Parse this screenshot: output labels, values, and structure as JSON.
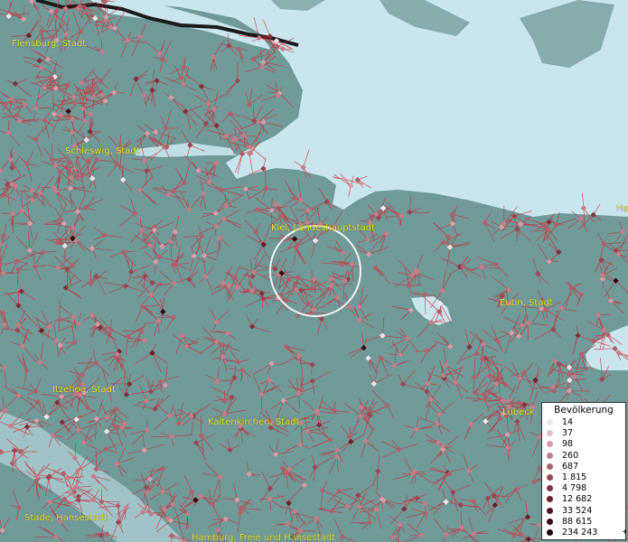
{
  "map": {
    "colors": {
      "land": "#6f9a98",
      "water": "#c9e6ee",
      "boundary": "#d4202a",
      "label": "#e8e23a"
    },
    "places": [
      {
        "id": "flensburg",
        "label": "Flensburg, Stadt"
      },
      {
        "id": "schleswig",
        "label": "Schleswig, Stadt"
      },
      {
        "id": "kiel",
        "label": "Kiel, Landeshauptstadt"
      },
      {
        "id": "eutin",
        "label": "Eutin, Stadt"
      },
      {
        "id": "itzehoe",
        "label": "Itzehoe, Stadt"
      },
      {
        "id": "kaltenkirchen",
        "label": "Kaltenkirchen, Stadt"
      },
      {
        "id": "luebeck",
        "label": "Lübeck,"
      },
      {
        "id": "stade",
        "label": "Stade, Hansestadt"
      },
      {
        "id": "hamburg",
        "label": "Hamburg, Freie und Hansestadt"
      },
      {
        "id": "he-cut",
        "label": "He"
      }
    ]
  },
  "legend": {
    "title": "Bevölkerung",
    "entries": [
      {
        "label": "14",
        "color": "#f6e4ea"
      },
      {
        "label": "37",
        "color": "#e9bfca"
      },
      {
        "label": "98",
        "color": "#d89ca8"
      },
      {
        "label": "260",
        "color": "#c57d88"
      },
      {
        "label": "687",
        "color": "#b0606b"
      },
      {
        "label": "1 815",
        "color": "#994752"
      },
      {
        "label": "4 798",
        "color": "#81323c"
      },
      {
        "label": "12 682",
        "color": "#68212a"
      },
      {
        "label": "33 524",
        "color": "#4e141b"
      },
      {
        "label": "88 615",
        "color": "#360b10"
      },
      {
        "label": "234 243",
        "color": "#1d0407"
      }
    ],
    "plus": "+"
  }
}
